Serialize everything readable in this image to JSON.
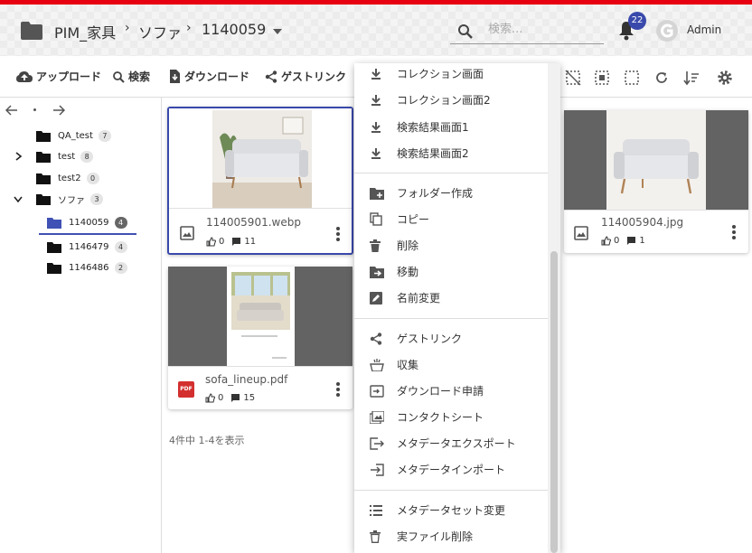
{
  "header": {
    "breadcrumb": [
      "PIM_家具",
      "ソファ",
      "1140059"
    ],
    "search_placeholder": "検索...",
    "notification_count": "22",
    "user": "Admin"
  },
  "toolbar": {
    "upload": "アップロード",
    "search": "検索",
    "download": "ダウンロード",
    "guestlink": "ゲストリンク"
  },
  "tree": {
    "items": [
      {
        "label": "QA_test",
        "count": "7"
      },
      {
        "label": "test",
        "count": "8"
      },
      {
        "label": "test2",
        "count": "0"
      },
      {
        "label": "ソファ",
        "count": "3"
      },
      {
        "label": "1140059",
        "count": "4"
      },
      {
        "label": "1146479",
        "count": "4"
      },
      {
        "label": "1146486",
        "count": "2"
      }
    ]
  },
  "cards": [
    {
      "name": "114005901.webp",
      "likes": "0",
      "comments": "11"
    },
    {
      "name": "sofa_lineup.pdf",
      "likes": "0",
      "comments": "15"
    },
    {
      "name": "114005904.jpg",
      "likes": "0",
      "comments": "1"
    }
  ],
  "status": "4件中 1-4を表示",
  "menu": {
    "items": [
      {
        "label": "コレクション画面",
        "icon": "download-icon"
      },
      {
        "label": "コレクション画面2",
        "icon": "download-icon"
      },
      {
        "label": "検索結果画面1",
        "icon": "download-icon"
      },
      {
        "label": "検索結果画面2",
        "icon": "download-icon"
      },
      {
        "label": "フォルダー作成",
        "icon": "create-folder-icon"
      },
      {
        "label": "コピー",
        "icon": "copy-icon"
      },
      {
        "label": "削除",
        "icon": "trash-icon"
      },
      {
        "label": "移動",
        "icon": "move-folder-icon"
      },
      {
        "label": "名前変更",
        "icon": "rename-icon"
      },
      {
        "label": "ゲストリンク",
        "icon": "share-icon"
      },
      {
        "label": "収集",
        "icon": "collect-icon"
      },
      {
        "label": "ダウンロード申請",
        "icon": "download-request-icon"
      },
      {
        "label": "コンタクトシート",
        "icon": "contact-sheet-icon"
      },
      {
        "label": "メタデータエクスポート",
        "icon": "export-icon"
      },
      {
        "label": "メタデータインポート",
        "icon": "import-icon"
      },
      {
        "label": "メタデータセット変更",
        "icon": "list-icon"
      },
      {
        "label": "実ファイル削除",
        "icon": "trash-outline-icon"
      }
    ]
  },
  "colors": {
    "accent": "#e60012",
    "selection": "#3949ab"
  }
}
